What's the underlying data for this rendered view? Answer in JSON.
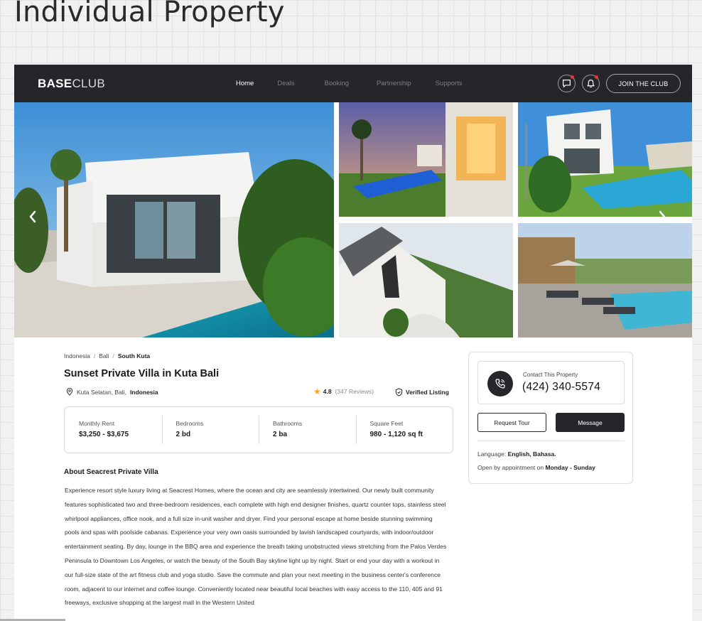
{
  "page_title": "Individual Property",
  "nav": {
    "logo_bold": "BASE",
    "logo_light": "CLUB",
    "links": [
      "Home",
      "Deals",
      "Booking",
      "Partnership",
      "Supports"
    ],
    "active_link": "Home",
    "join_label": "JOIN THE CLUB"
  },
  "gallery": {
    "prev_icon": "chevron-left-icon",
    "next_icon": "chevron-right-icon"
  },
  "breadcrumb": [
    "Indonesia",
    "Bali",
    "South Kuta"
  ],
  "property": {
    "title": "Sunset Private Villa in Kuta Bali",
    "location_prefix": "Kuta Selatan, Bali,",
    "location_country": "Indonesia",
    "rating": "4.8",
    "reviews": "(347 Reviews)",
    "verified": "Verified Listing"
  },
  "stats": [
    {
      "label": "Monthly Rent",
      "value": "$3,250 - $3,675"
    },
    {
      "label": "Bedrooms",
      "value": "2 bd"
    },
    {
      "label": "Bathrooms",
      "value": "2 ba"
    },
    {
      "label": "Square Feet",
      "value": "980 - 1,120 sq ft"
    }
  ],
  "about": {
    "heading": "About Seacrest Private Villa",
    "body": "Experience resort style luxury living at Seacrest Homes, where the ocean and city are seamlessly intertwined. Our newly built community features sophisticated two and three-bedroom residences, each complete with high end designer finishes, quartz counter tops, stainless steel whirlpool appliances, office nook, and a full size in-unit washer and dryer. Find your personal escape at home beside stunning swimming pools and spas with poolside cabanas. Experience your very own oasis surrounded by lavish landscaped courtyards, with indoor/outdoor entertainment seating. By day, lounge in the BBQ area and experience the breath taking unobstructed views stretching from the Palos Verdes Peninsula to Downtown Los Angeles, or watch the beauty of the South Bay skyline light up by night. Start or end your day with a workout in our full-size state of the art fitness club and yoga studio. Save the commute and plan your next meeting in the business center's conference room, adjacent to our internet and coffee lounge. Conveniently located near beautiful local beaches with easy access to the 110, 405 and 91 freeways, exclusive shopping at the largest mall in the Western United"
  },
  "contact": {
    "label": "Contact This Property",
    "phone": "(424) 340-5574",
    "tour_button": "Request Tour",
    "message_button": "Message",
    "language_label": "Language:",
    "language_value": "English, Bahasa.",
    "open_label": "Open by appointment on",
    "open_value": "Monday - Sunday"
  },
  "colors": {
    "nav_bg": "#26262a",
    "accent_star": "#f4a623",
    "notification_dot": "#e53935"
  }
}
